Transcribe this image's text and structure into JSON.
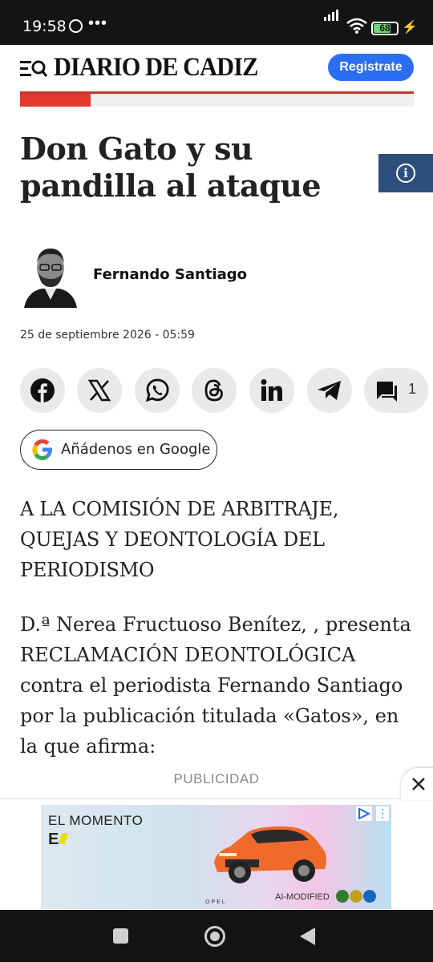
{
  "status_bar": {
    "time": "19:58",
    "battery": "68"
  },
  "header": {
    "logo": "DIARIO DE CADIZ",
    "register_label": "Registrate",
    "reading_progress": 0.18
  },
  "article": {
    "title": "Don Gato y su pandilla al ataque",
    "author": "Fernando Santiago",
    "date": "25 de septiembre 2026 - 05:59",
    "comment_count": "1",
    "google_button": "Añádenos en Google",
    "paragraphs": [
      "A LA COMISIÓN DE ARBITRAJE, QUEJAS Y DEONTOLOGÍA DEL PERIODISMO",
      "D.ª Nerea Fructuoso Benítez, , presenta RECLAMACIÓN DEONTOLÓGICA contra el periodista Fernando Santiago por la publicación titulada «Gatos», en la que afirma:"
    ]
  },
  "share": [
    "facebook-icon",
    "x-icon",
    "whatsapp-icon",
    "threads-icon",
    "linkedin-icon",
    "telegram-icon",
    "comment-icon"
  ],
  "ad": {
    "label": "PUBLICIDAD",
    "headline": "EL MOMENTO",
    "e_mark": "E",
    "brand": "OPEL",
    "ai_text": "AI-MODIFIED"
  },
  "colors": {
    "brand_red": "#e03a2e",
    "register_blue": "#2c6ef2",
    "info_blue": "#2d4f7c"
  }
}
